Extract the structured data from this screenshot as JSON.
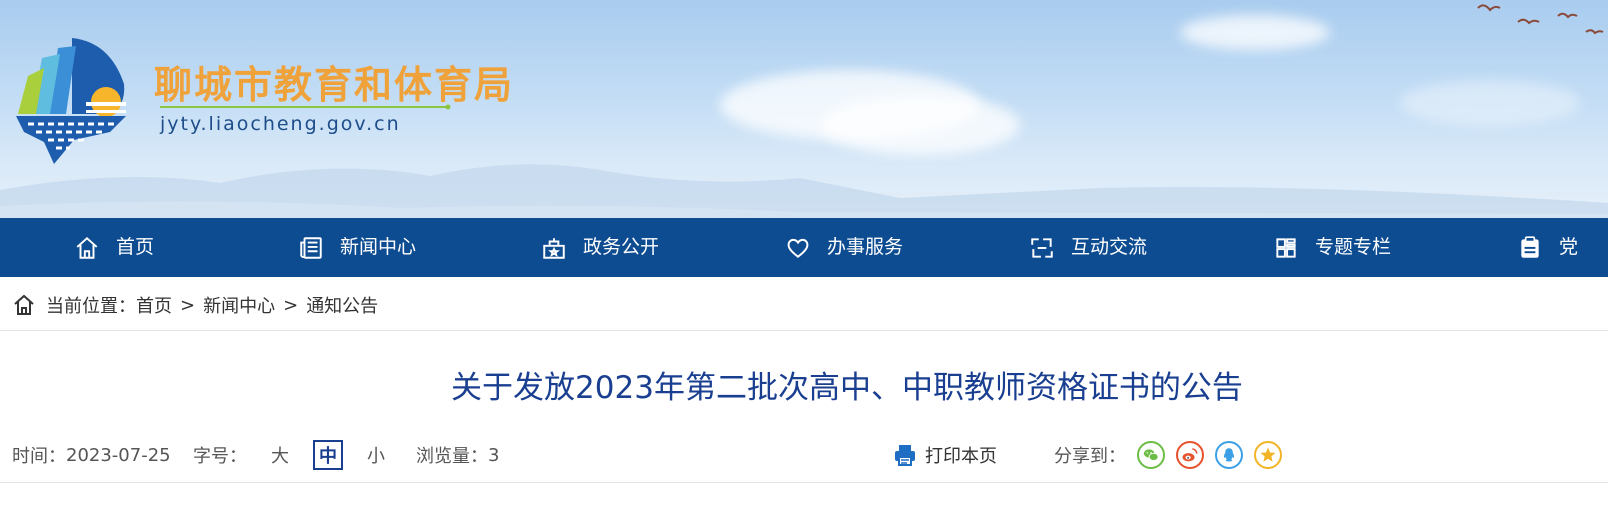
{
  "header": {
    "site_name": "聊城市教育和体育局",
    "site_url": "jyty.liaocheng.gov.cn"
  },
  "nav": {
    "items": [
      {
        "label": "首页",
        "icon": "home-icon"
      },
      {
        "label": "新闻中心",
        "icon": "newspaper-icon"
      },
      {
        "label": "政务公开",
        "icon": "government-affairs-icon"
      },
      {
        "label": "办事服务",
        "icon": "heart-icon"
      },
      {
        "label": "互动交流",
        "icon": "interaction-icon"
      },
      {
        "label": "专题专栏",
        "icon": "grid-icon"
      },
      {
        "label": "党",
        "icon": "document-icon"
      }
    ]
  },
  "breadcrumb": {
    "prefix": "当前位置：",
    "items": [
      "首页",
      "新闻中心",
      "通知公告"
    ],
    "separator": ">"
  },
  "article": {
    "title": "关于发放2023年第二批次高中、中职教师资格证书的公告",
    "date_label": "时间：",
    "date": "2023-07-25",
    "font_size_label": "字号：",
    "font_size_options": [
      "大",
      "中",
      "小"
    ],
    "font_size_selected": "中",
    "views_label": "浏览量：",
    "views": "3",
    "print_label": "打印本页",
    "share_label": "分享到："
  },
  "share_icons": [
    {
      "name": "wechat-icon",
      "color": "#6cbd45"
    },
    {
      "name": "weibo-icon",
      "color": "#e6522c"
    },
    {
      "name": "qq-icon",
      "color": "#3ba0e6"
    },
    {
      "name": "qzone-icon",
      "color": "#f2b427"
    }
  ],
  "colors": {
    "nav_bg": "#0e4c92",
    "title_blue": "#1a3f91",
    "site_name_orange": "#f0a23a"
  }
}
